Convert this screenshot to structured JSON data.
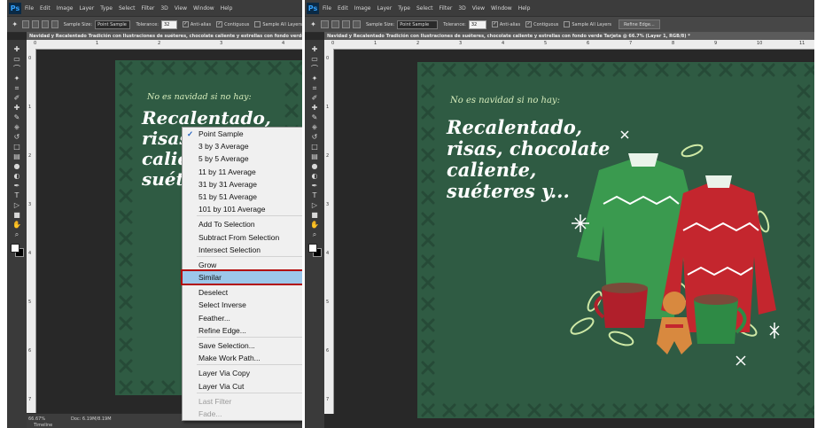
{
  "app": {
    "logo": "Ps",
    "menu": [
      "File",
      "Edit",
      "Image",
      "Layer",
      "Type",
      "Select",
      "Filter",
      "3D",
      "View",
      "Window",
      "Help"
    ]
  },
  "options": {
    "sample_size_label": "Sample Size:",
    "sample_size_value": "Point Sample",
    "tolerance_label": "Tolerance:",
    "tolerance_value": "32",
    "antialias": "Anti-alias",
    "contiguous": "Contiguous",
    "sample_all_layers": "Sample All Layers",
    "refine_edge": "Refine Edge..."
  },
  "document": {
    "title": "Navidad y Recalentado Tradición con Ilustraciones de suéteres, chocolate caliente y estrellas con fondo verde Tarjeta @ 66.7% (Layer 1, RGB/8) *"
  },
  "ruler": {
    "left_ticks": [
      "0",
      "1",
      "2",
      "3",
      "4"
    ],
    "right_ticks": [
      "0",
      "1",
      "2",
      "3",
      "4",
      "5",
      "6",
      "7",
      "8",
      "9",
      "10",
      "11"
    ],
    "vertical_ticks": [
      "0",
      "1",
      "2",
      "3",
      "4",
      "5",
      "6",
      "7"
    ]
  },
  "card": {
    "headline": "No es navidad si no hay:",
    "text": "Recalentado,\nrisas, chocolate\ncaliente,\nsuéteres y...",
    "text_left_visible": "Recalentado,\nrisas,\ncaliente\nsuéter"
  },
  "status": {
    "zoom": "66.67%",
    "doc": "Doc: 6.19M/8.19M",
    "timeline": "Timeline"
  },
  "context_menu": [
    {
      "label": "Point Sample",
      "checked": true
    },
    {
      "label": "3 by 3 Average"
    },
    {
      "label": "5 by 5 Average"
    },
    {
      "label": "11 by 11 Average"
    },
    {
      "label": "31 by 31 Average"
    },
    {
      "label": "51 by 51 Average"
    },
    {
      "label": "101 by 101 Average"
    },
    {
      "label": "Add To Selection",
      "sep_before": true
    },
    {
      "label": "Subtract From Selection"
    },
    {
      "label": "Intersect Selection"
    },
    {
      "label": "Grow",
      "sep_before": true
    },
    {
      "label": "Similar",
      "highlight": true
    },
    {
      "label": "Deselect",
      "sep_before": true
    },
    {
      "label": "Select Inverse"
    },
    {
      "label": "Feather..."
    },
    {
      "label": "Refine Edge..."
    },
    {
      "label": "Save Selection...",
      "sep_before": true
    },
    {
      "label": "Make Work Path..."
    },
    {
      "label": "Layer Via Copy",
      "sep_before": true
    },
    {
      "label": "Layer Via Cut"
    },
    {
      "label": "Last Filter",
      "disabled": true,
      "sep_before": true
    },
    {
      "label": "Fade...",
      "disabled": true
    }
  ],
  "colors": {
    "card_green": "#2f5b43",
    "sweater_red": "#c4262e",
    "sweater_green": "#3a9a4f",
    "highlight_outline": "#b20a0a"
  },
  "tools": [
    "move-icon",
    "marquee-icon",
    "lasso-icon",
    "magic-wand-icon",
    "crop-icon",
    "eyedropper-icon",
    "healing-icon",
    "brush-icon",
    "stamp-icon",
    "history-brush-icon",
    "eraser-icon",
    "gradient-icon",
    "blur-icon",
    "dodge-icon",
    "pen-icon",
    "type-icon",
    "path-select-icon",
    "shape-icon",
    "hand-icon",
    "zoom-icon"
  ]
}
